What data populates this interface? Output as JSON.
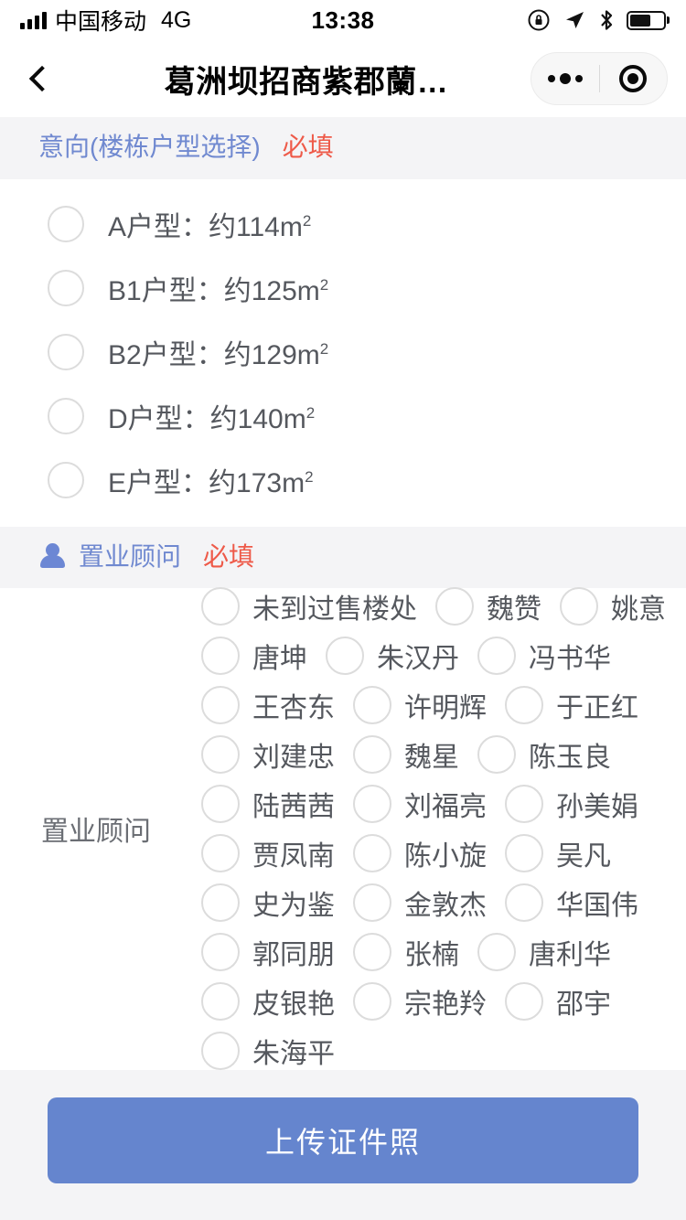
{
  "status_bar": {
    "carrier": "中国移动",
    "network": "4G",
    "time": "13:38",
    "icons": [
      "signal-bars",
      "rotation-lock-icon",
      "location-arrow-icon",
      "bluetooth-icon",
      "battery-icon"
    ],
    "battery_level": "62%"
  },
  "nav_bar": {
    "back_label": "back-chevron",
    "title": "葛洲坝招商紫郡蘭…",
    "capsule": {
      "menu_label": "more-menu",
      "close_label": "close-target"
    }
  },
  "sections": [
    {
      "title": "意向(楼栋户型选择)",
      "required_label": "必填",
      "icon": null,
      "options": [
        {
          "label": "A户型：约114m",
          "unit_sup": "2",
          "selected": false
        },
        {
          "label": "B1户型：约125m",
          "unit_sup": "2",
          "selected": false
        },
        {
          "label": "B2户型：约129m",
          "unit_sup": "2",
          "selected": false
        },
        {
          "label": "D户型：约140m",
          "unit_sup": "2",
          "selected": false
        },
        {
          "label": "E户型：约173m",
          "unit_sup": "2",
          "selected": false
        }
      ]
    },
    {
      "title": "置业顾问",
      "required_label": "必填",
      "icon": "person-icon",
      "row_label": "置业顾问",
      "consultants": [
        {
          "name": "未到过售楼处",
          "selected": false
        },
        {
          "name": "魏赞",
          "selected": false
        },
        {
          "name": "姚意",
          "selected": false
        },
        {
          "name": "唐坤",
          "selected": false
        },
        {
          "name": "朱汉丹",
          "selected": false
        },
        {
          "name": "冯书华",
          "selected": false
        },
        {
          "name": "王杏东",
          "selected": false
        },
        {
          "name": "许明辉",
          "selected": false
        },
        {
          "name": "于正红",
          "selected": false
        },
        {
          "name": "刘建忠",
          "selected": false
        },
        {
          "name": "魏星",
          "selected": false
        },
        {
          "name": "陈玉良",
          "selected": false
        },
        {
          "name": "陆茜茜",
          "selected": false
        },
        {
          "name": "刘福亮",
          "selected": false
        },
        {
          "name": "孙美娟",
          "selected": false
        },
        {
          "name": "贾凤南",
          "selected": false
        },
        {
          "name": "陈小旋",
          "selected": false
        },
        {
          "name": "吴凡",
          "selected": false
        },
        {
          "name": "史为鉴",
          "selected": false
        },
        {
          "name": "金敦杰",
          "selected": false
        },
        {
          "name": "华国伟",
          "selected": false
        },
        {
          "name": "郭同朋",
          "selected": false
        },
        {
          "name": "张楠",
          "selected": false
        },
        {
          "name": "唐利华",
          "selected": false
        },
        {
          "name": "皮银艳",
          "selected": false
        },
        {
          "name": "宗艳羚",
          "selected": false
        },
        {
          "name": "邵宇",
          "selected": false
        },
        {
          "name": "朱海平",
          "selected": false
        }
      ]
    }
  ],
  "footer": {
    "submit_label": "上传证件照"
  },
  "colors": {
    "accent_blue": "#7089d0",
    "required_red": "#ee5a49",
    "button_blue": "#6585ce",
    "band_gray": "#f4f4f6",
    "text_gray": "#55585e",
    "radio_border": "#dcdcdc"
  }
}
